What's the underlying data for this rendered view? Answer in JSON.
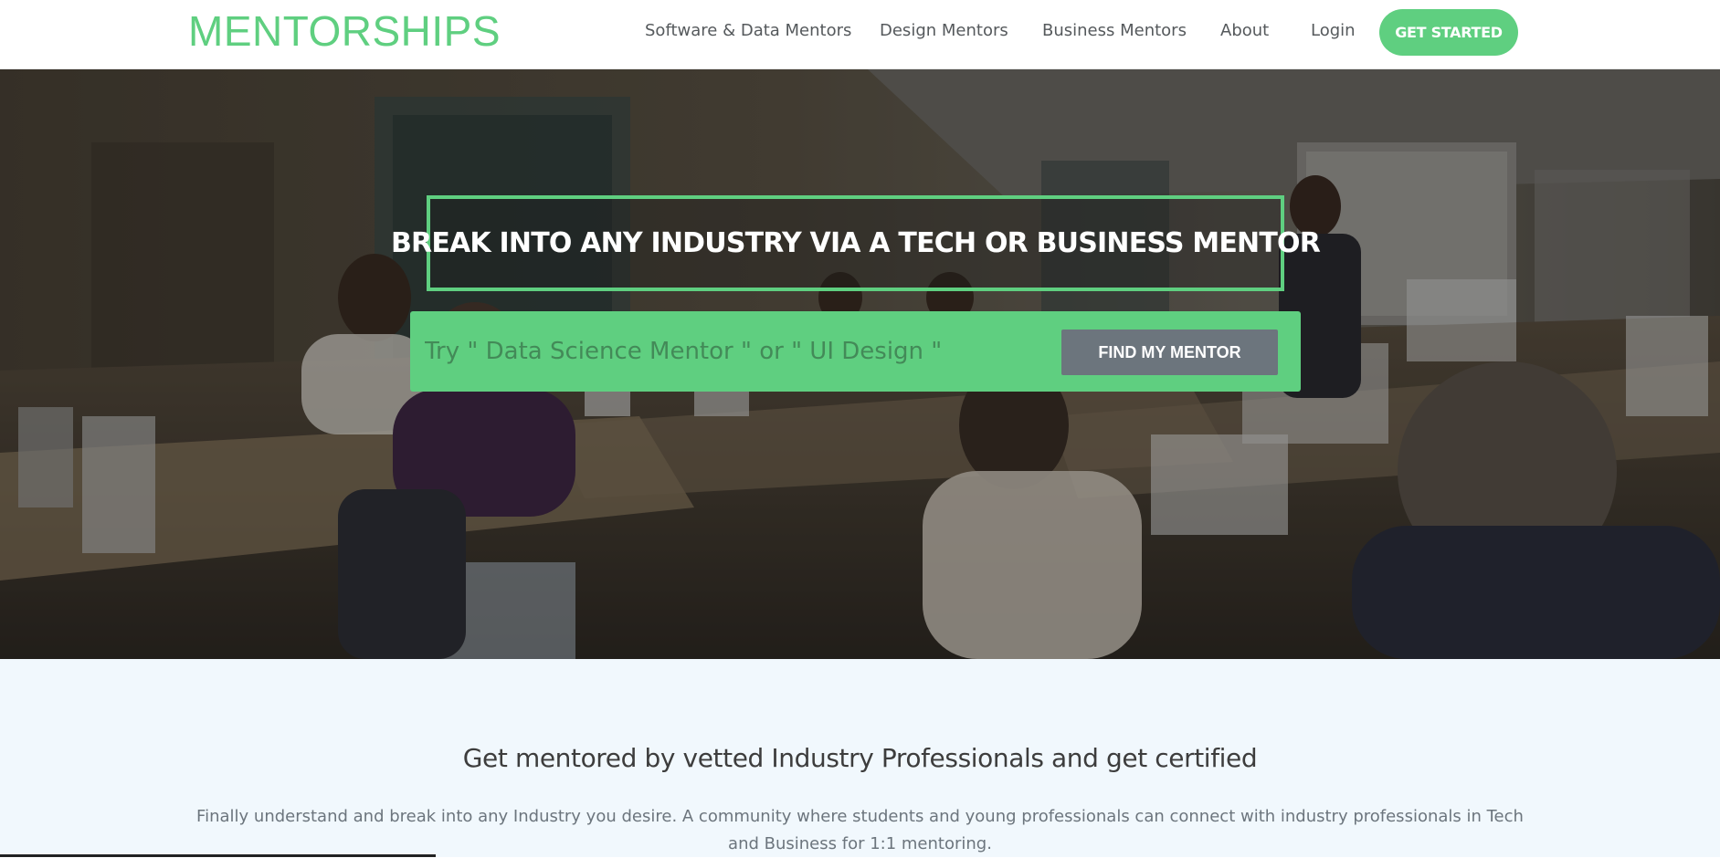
{
  "brand": {
    "name": "MENTORSHIPS",
    "color": "#5fcf80"
  },
  "nav": {
    "items": [
      {
        "id": "software",
        "label": "Software & Data Mentors"
      },
      {
        "id": "design",
        "label": "Design Mentors"
      },
      {
        "id": "business",
        "label": "Business Mentors"
      },
      {
        "id": "about",
        "label": "About"
      },
      {
        "id": "login",
        "label": "Login"
      }
    ],
    "cta_label": "GET STARTED"
  },
  "hero": {
    "title": "BREAK INTO ANY INDUSTRY VIA A TECH OR BUSINESS MENTOR",
    "search": {
      "placeholder": "Try \" Data Science Mentor \" or \" UI Design \"",
      "value": "",
      "button_label": "FIND MY MENTOR"
    },
    "background": "classroom photo"
  },
  "about": {
    "heading": "Get mentored by vetted Industry Professionals and get certified",
    "text": "Finally understand and break into any Industry you desire. A community where students and young professionals can connect with industry professionals in Tech and Business for 1:1 mentoring."
  },
  "colors": {
    "accent": "#5fcf80",
    "button_gray": "#6c757d",
    "section_bg": "#f1f8fd"
  }
}
